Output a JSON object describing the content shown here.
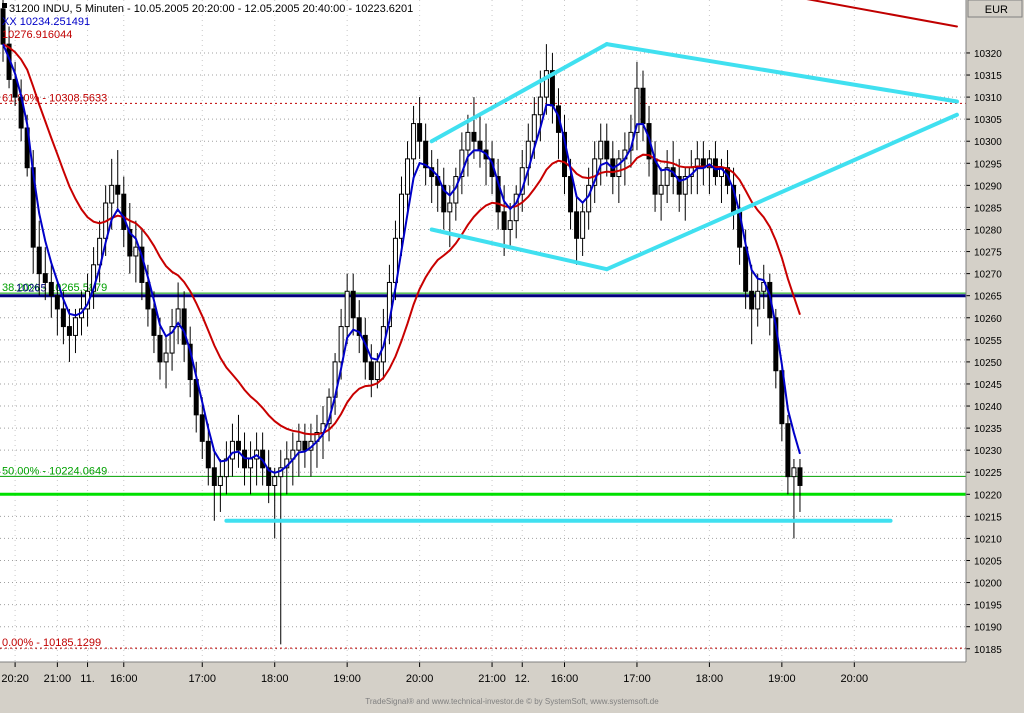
{
  "header": {
    "line1": "31200  INDU, 5 Minuten - 10.05.2005 20:20:00 - 12.05.2005 20:40:00 - 10223.6201",
    "line2": "XX 10234.251491",
    "line3": "10276.916044",
    "currency": "EUR"
  },
  "footer": {
    "credit": "TradeSignal® and www.technical-investor.de © by SystemSoft, www.systemsoft.de"
  },
  "colors": {
    "background": "#ffffff",
    "panel": "#d4d0c8",
    "candle": "#000000",
    "ma_fast": "#0000c8",
    "ma_slow": "#c80000",
    "fib_red": "#c00000",
    "fib_green": "#00a000",
    "level_blue": "#000080",
    "support_green": "#00e000",
    "drawing_cyan": "#40e0f0"
  },
  "chart_data": {
    "type": "candlestick",
    "symbol": "INDU",
    "interval": "5 Minuten",
    "ylim": [
      10182,
      10332
    ],
    "y_ticks": [
      10185,
      10190,
      10195,
      10200,
      10205,
      10210,
      10215,
      10220,
      10225,
      10230,
      10235,
      10240,
      10245,
      10250,
      10255,
      10260,
      10265,
      10270,
      10275,
      10280,
      10285,
      10290,
      10295,
      10300,
      10305,
      10310,
      10315,
      10320
    ],
    "x_axis_labels": [
      "20:20",
      "21:00",
      "11.",
      "16:00",
      "17:00",
      "18:00",
      "19:00",
      "20:00",
      "21:00",
      "12.",
      "16:00",
      "17:00",
      "18:00",
      "19:00",
      "20:00"
    ],
    "x_label_bar_index": [
      2,
      9,
      14,
      20,
      33,
      45,
      57,
      69,
      81,
      86,
      93,
      105,
      117,
      129,
      141
    ],
    "bar_count": 160,
    "last_bar_index": 145,
    "candles": [
      [
        10330,
        10332,
        10318,
        10322
      ],
      [
        10322,
        10326,
        10312,
        10314
      ],
      [
        10314,
        10318,
        10308,
        10310
      ],
      [
        10310,
        10314,
        10300,
        10303
      ],
      [
        10303,
        10306,
        10292,
        10294
      ],
      [
        10294,
        10298,
        10270,
        10276
      ],
      [
        10276,
        10282,
        10265,
        10270
      ],
      [
        10270,
        10276,
        10264,
        10268
      ],
      [
        10268,
        10272,
        10260,
        10265
      ],
      [
        10265,
        10268,
        10256,
        10262
      ],
      [
        10262,
        10266,
        10254,
        10258
      ],
      [
        10258,
        10262,
        10250,
        10256
      ],
      [
        10256,
        10262,
        10252,
        10260
      ],
      [
        10260,
        10266,
        10256,
        10262
      ],
      [
        10262,
        10270,
        10258,
        10266
      ],
      [
        10266,
        10276,
        10262,
        10272
      ],
      [
        10272,
        10282,
        10268,
        10278
      ],
      [
        10278,
        10290,
        10274,
        10286
      ],
      [
        10286,
        10296,
        10280,
        10290
      ],
      [
        10290,
        10298,
        10284,
        10288
      ],
      [
        10288,
        10292,
        10276,
        10280
      ],
      [
        10280,
        10286,
        10270,
        10274
      ],
      [
        10274,
        10282,
        10268,
        10276
      ],
      [
        10276,
        10280,
        10264,
        10268
      ],
      [
        10268,
        10272,
        10258,
        10262
      ],
      [
        10262,
        10266,
        10252,
        10256
      ],
      [
        10256,
        10260,
        10246,
        10250
      ],
      [
        10250,
        10256,
        10244,
        10252
      ],
      [
        10252,
        10262,
        10248,
        10258
      ],
      [
        10258,
        10268,
        10254,
        10262
      ],
      [
        10262,
        10266,
        10250,
        10254
      ],
      [
        10254,
        10258,
        10242,
        10246
      ],
      [
        10246,
        10250,
        10234,
        10238
      ],
      [
        10238,
        10242,
        10228,
        10232
      ],
      [
        10232,
        10236,
        10222,
        10226
      ],
      [
        10226,
        10230,
        10214,
        10222
      ],
      [
        10222,
        10228,
        10216,
        10224
      ],
      [
        10224,
        10232,
        10220,
        10228
      ],
      [
        10228,
        10236,
        10224,
        10232
      ],
      [
        10232,
        10238,
        10226,
        10230
      ],
      [
        10230,
        10234,
        10222,
        10226
      ],
      [
        10226,
        10232,
        10220,
        10228
      ],
      [
        10228,
        10234,
        10222,
        10230
      ],
      [
        10230,
        10234,
        10222,
        10226
      ],
      [
        10226,
        10230,
        10218,
        10222
      ],
      [
        10222,
        10226,
        10210,
        10224
      ],
      [
        10224,
        10230,
        10186,
        10226
      ],
      [
        10226,
        10232,
        10220,
        10228
      ],
      [
        10228,
        10234,
        10222,
        10230
      ],
      [
        10230,
        10236,
        10224,
        10232
      ],
      [
        10232,
        10236,
        10226,
        10230
      ],
      [
        10230,
        10236,
        10224,
        10232
      ],
      [
        10232,
        10238,
        10226,
        10234
      ],
      [
        10234,
        10240,
        10228,
        10236
      ],
      [
        10236,
        10244,
        10232,
        10242
      ],
      [
        10242,
        10252,
        10238,
        10250
      ],
      [
        10250,
        10262,
        10246,
        10258
      ],
      [
        10258,
        10270,
        10254,
        10266
      ],
      [
        10266,
        10270,
        10256,
        10260
      ],
      [
        10260,
        10264,
        10252,
        10256
      ],
      [
        10256,
        10260,
        10246,
        10250
      ],
      [
        10250,
        10254,
        10242,
        10246
      ],
      [
        10246,
        10252,
        10244,
        10250
      ],
      [
        10250,
        10262,
        10246,
        10258
      ],
      [
        10258,
        10272,
        10254,
        10268
      ],
      [
        10268,
        10282,
        10264,
        10278
      ],
      [
        10278,
        10292,
        10274,
        10288
      ],
      [
        10288,
        10300,
        10284,
        10296
      ],
      [
        10296,
        10308,
        10292,
        10304
      ],
      [
        10304,
        10310,
        10296,
        10300
      ],
      [
        10300,
        10304,
        10290,
        10294
      ],
      [
        10294,
        10298,
        10286,
        10292
      ],
      [
        10292,
        10296,
        10284,
        10290
      ],
      [
        10290,
        10294,
        10280,
        10284
      ],
      [
        10284,
        10290,
        10276,
        10286
      ],
      [
        10286,
        10294,
        10282,
        10292
      ],
      [
        10292,
        10302,
        10288,
        10298
      ],
      [
        10298,
        10306,
        10292,
        10302
      ],
      [
        10302,
        10310,
        10296,
        10300
      ],
      [
        10300,
        10306,
        10294,
        10298
      ],
      [
        10298,
        10304,
        10290,
        10296
      ],
      [
        10296,
        10300,
        10288,
        10292
      ],
      [
        10292,
        10296,
        10280,
        10284
      ],
      [
        10284,
        10290,
        10274,
        10280
      ],
      [
        10280,
        10286,
        10276,
        10282
      ],
      [
        10282,
        10290,
        10278,
        10288
      ],
      [
        10288,
        10298,
        10284,
        10294
      ],
      [
        10294,
        10304,
        10290,
        10300
      ],
      [
        10300,
        10310,
        10296,
        10306
      ],
      [
        10306,
        10316,
        10300,
        10310
      ],
      [
        10310,
        10322,
        10306,
        10316
      ],
      [
        10316,
        10320,
        10304,
        10308
      ],
      [
        10308,
        10312,
        10296,
        10302
      ],
      [
        10302,
        10306,
        10288,
        10292
      ],
      [
        10292,
        10296,
        10280,
        10284
      ],
      [
        10284,
        10288,
        10272,
        10278
      ],
      [
        10278,
        10286,
        10274,
        10284
      ],
      [
        10284,
        10294,
        10280,
        10290
      ],
      [
        10290,
        10300,
        10286,
        10296
      ],
      [
        10296,
        10304,
        10290,
        10300
      ],
      [
        10300,
        10304,
        10292,
        10296
      ],
      [
        10296,
        10300,
        10288,
        10292
      ],
      [
        10292,
        10298,
        10286,
        10296
      ],
      [
        10296,
        10302,
        10290,
        10298
      ],
      [
        10298,
        10306,
        10294,
        10302
      ],
      [
        10302,
        10318,
        10298,
        10312
      ],
      [
        10312,
        10316,
        10300,
        10304
      ],
      [
        10304,
        10308,
        10292,
        10296
      ],
      [
        10296,
        10300,
        10284,
        10288
      ],
      [
        10288,
        10294,
        10282,
        10290
      ],
      [
        10290,
        10298,
        10286,
        10294
      ],
      [
        10294,
        10300,
        10288,
        10292
      ],
      [
        10292,
        10296,
        10284,
        10288
      ],
      [
        10288,
        10294,
        10282,
        10292
      ],
      [
        10292,
        10298,
        10288,
        10294
      ],
      [
        10294,
        10300,
        10288,
        10296
      ],
      [
        10296,
        10300,
        10290,
        10294
      ],
      [
        10294,
        10298,
        10288,
        10296
      ],
      [
        10296,
        10300,
        10290,
        10292
      ],
      [
        10292,
        10296,
        10286,
        10294
      ],
      [
        10294,
        10298,
        10288,
        10290
      ],
      [
        10290,
        10294,
        10280,
        10284
      ],
      [
        10284,
        10288,
        10272,
        10276
      ],
      [
        10276,
        10280,
        10262,
        10266
      ],
      [
        10266,
        10272,
        10254,
        10262
      ],
      [
        10262,
        10270,
        10258,
        10266
      ],
      [
        10266,
        10272,
        10262,
        10268
      ],
      [
        10268,
        10270,
        10256,
        10260
      ],
      [
        10260,
        10262,
        10244,
        10248
      ],
      [
        10248,
        10250,
        10232,
        10236
      ],
      [
        10236,
        10238,
        10220,
        10224
      ],
      [
        10224,
        10228,
        10210,
        10226
      ],
      [
        10226,
        10228,
        10216,
        10222
      ]
    ],
    "ma_fast_label": "XX 10234.251491",
    "ma_slow_label": "10276.916044",
    "horizontal_levels": [
      {
        "label": "61.80% - 10308.5633",
        "value": 10308.5633,
        "style": "dotted",
        "color": "#c00000"
      },
      {
        "label": "38.20% - 10265.5879",
        "value": 10265.5879,
        "style": "solid",
        "color": "#00a000"
      },
      {
        "label": "50.00% - 10224.0649",
        "value": 10224.0649,
        "style": "solid",
        "color": "#00a000"
      },
      {
        "label": "0.00% - 10185.1299",
        "value": 10185.1299,
        "style": "dotted",
        "color": "#c00000"
      },
      {
        "label": "10265",
        "value": 10265,
        "style": "thick",
        "color": "#000080"
      },
      {
        "label": "",
        "value": 10220,
        "style": "thick",
        "color": "#00e000"
      }
    ],
    "trendlines": [
      {
        "color": "#40e0f0",
        "from": [
          71,
          10300
        ],
        "to": [
          100,
          10322
        ]
      },
      {
        "color": "#40e0f0",
        "from": [
          100,
          10322
        ],
        "to": [
          158,
          10309
        ]
      },
      {
        "color": "#40e0f0",
        "from": [
          71,
          10280
        ],
        "to": [
          100,
          10271
        ]
      },
      {
        "color": "#40e0f0",
        "from": [
          100,
          10271
        ],
        "to": [
          158,
          10306
        ]
      },
      {
        "color": "#40e0f0",
        "from": [
          37,
          10214
        ],
        "to": [
          147,
          10214
        ]
      },
      {
        "color": "#c00000",
        "from": [
          126,
          10334
        ],
        "to": [
          158,
          10326
        ]
      }
    ]
  }
}
